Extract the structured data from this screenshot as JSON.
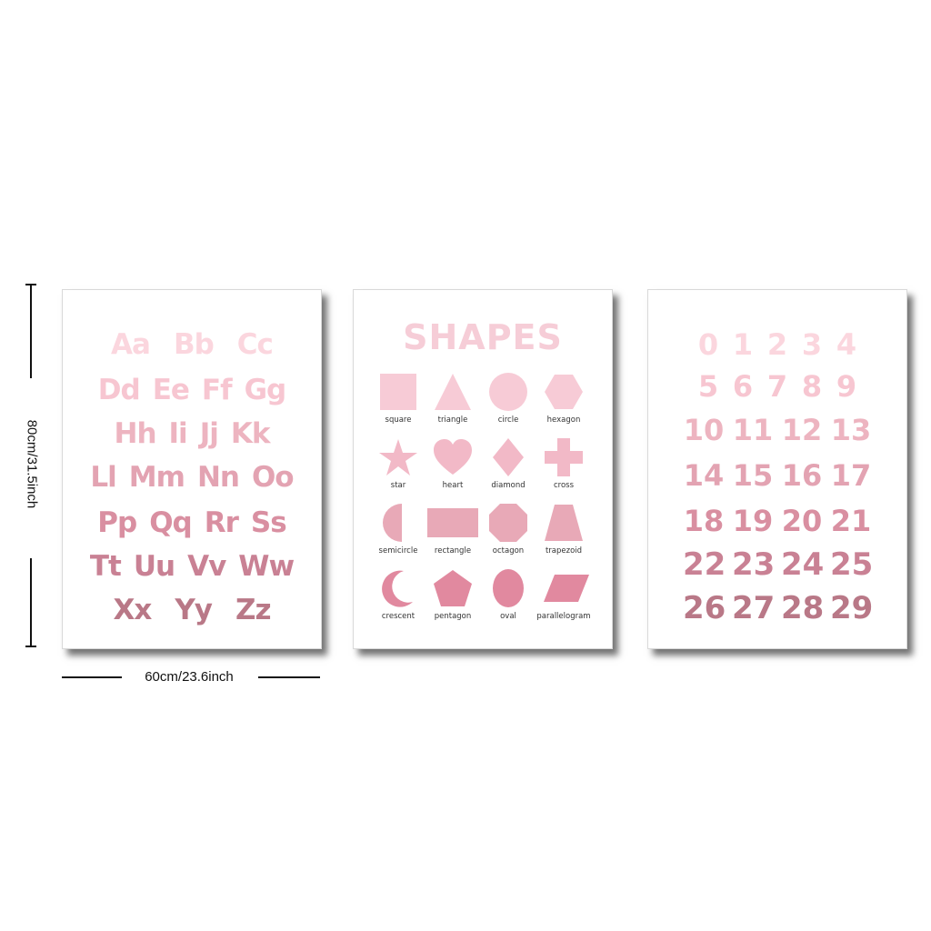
{
  "dimensions": {
    "height_label": "80cm/31.5inch",
    "width_label": "60cm/23.6inch"
  },
  "alphabet_poster": {
    "rows": [
      [
        "Aa",
        "Bb",
        "Cc"
      ],
      [
        "Dd",
        "Ee",
        "Ff",
        "Gg"
      ],
      [
        "Hh",
        "Ii",
        "Jj",
        "Kk"
      ],
      [
        "Ll",
        "Mm",
        "Nn",
        "Oo"
      ],
      [
        "Pp",
        "Qq",
        "Rr",
        "Ss"
      ],
      [
        "Tt",
        "Uu",
        "Vv",
        "Ww"
      ],
      [
        "Xx",
        "Yy",
        "Zz"
      ]
    ],
    "row_colors": [
      "#fbd6de",
      "#f7c6d1",
      "#edb4c0",
      "#e3a3b2",
      "#d98fa1",
      "#c98194",
      "#b97887"
    ]
  },
  "shapes_poster": {
    "title": "SHAPES",
    "shapes": [
      {
        "name": "square",
        "label": "square",
        "color": "#f7cbd6"
      },
      {
        "name": "triangle",
        "label": "triangle",
        "color": "#f7cbd6"
      },
      {
        "name": "circle",
        "label": "circle",
        "color": "#f7cbd6"
      },
      {
        "name": "hexagon",
        "label": "hexagon",
        "color": "#f7cbd6"
      },
      {
        "name": "star",
        "label": "star",
        "color": "#f2b9c7"
      },
      {
        "name": "heart",
        "label": "heart",
        "color": "#f2b9c7"
      },
      {
        "name": "diamond",
        "label": "diamond",
        "color": "#f2b9c7"
      },
      {
        "name": "cross",
        "label": "cross",
        "color": "#f2b9c7"
      },
      {
        "name": "semicircle",
        "label": "semicircle",
        "color": "#e8a9b7"
      },
      {
        "name": "rectangle",
        "label": "rectangle",
        "color": "#e8a9b7"
      },
      {
        "name": "octagon",
        "label": "octagon",
        "color": "#e8a9b7"
      },
      {
        "name": "trapezoid",
        "label": "trapezoid",
        "color": "#e8a9b7"
      },
      {
        "name": "crescent",
        "label": "crescent",
        "color": "#e1899f"
      },
      {
        "name": "pentagon",
        "label": "pentagon",
        "color": "#e1899f"
      },
      {
        "name": "oval",
        "label": "oval",
        "color": "#e1899f"
      },
      {
        "name": "parallelogram",
        "label": "parallelogram",
        "color": "#e1899f"
      }
    ]
  },
  "numbers_poster": {
    "rows": [
      [
        "0",
        "1",
        "2",
        "3",
        "4"
      ],
      [
        "5",
        "6",
        "7",
        "8",
        "9"
      ],
      [
        "10",
        "11",
        "12",
        "13"
      ],
      [
        "14",
        "15",
        "16",
        "17"
      ],
      [
        "18",
        "19",
        "20",
        "21"
      ],
      [
        "22",
        "23",
        "24",
        "25"
      ],
      [
        "26",
        "27",
        "28",
        "29"
      ]
    ],
    "row_colors": [
      "#fbd6de",
      "#f7c6d1",
      "#edb4c0",
      "#e3a3b2",
      "#d98fa1",
      "#c98194",
      "#b97887"
    ]
  }
}
